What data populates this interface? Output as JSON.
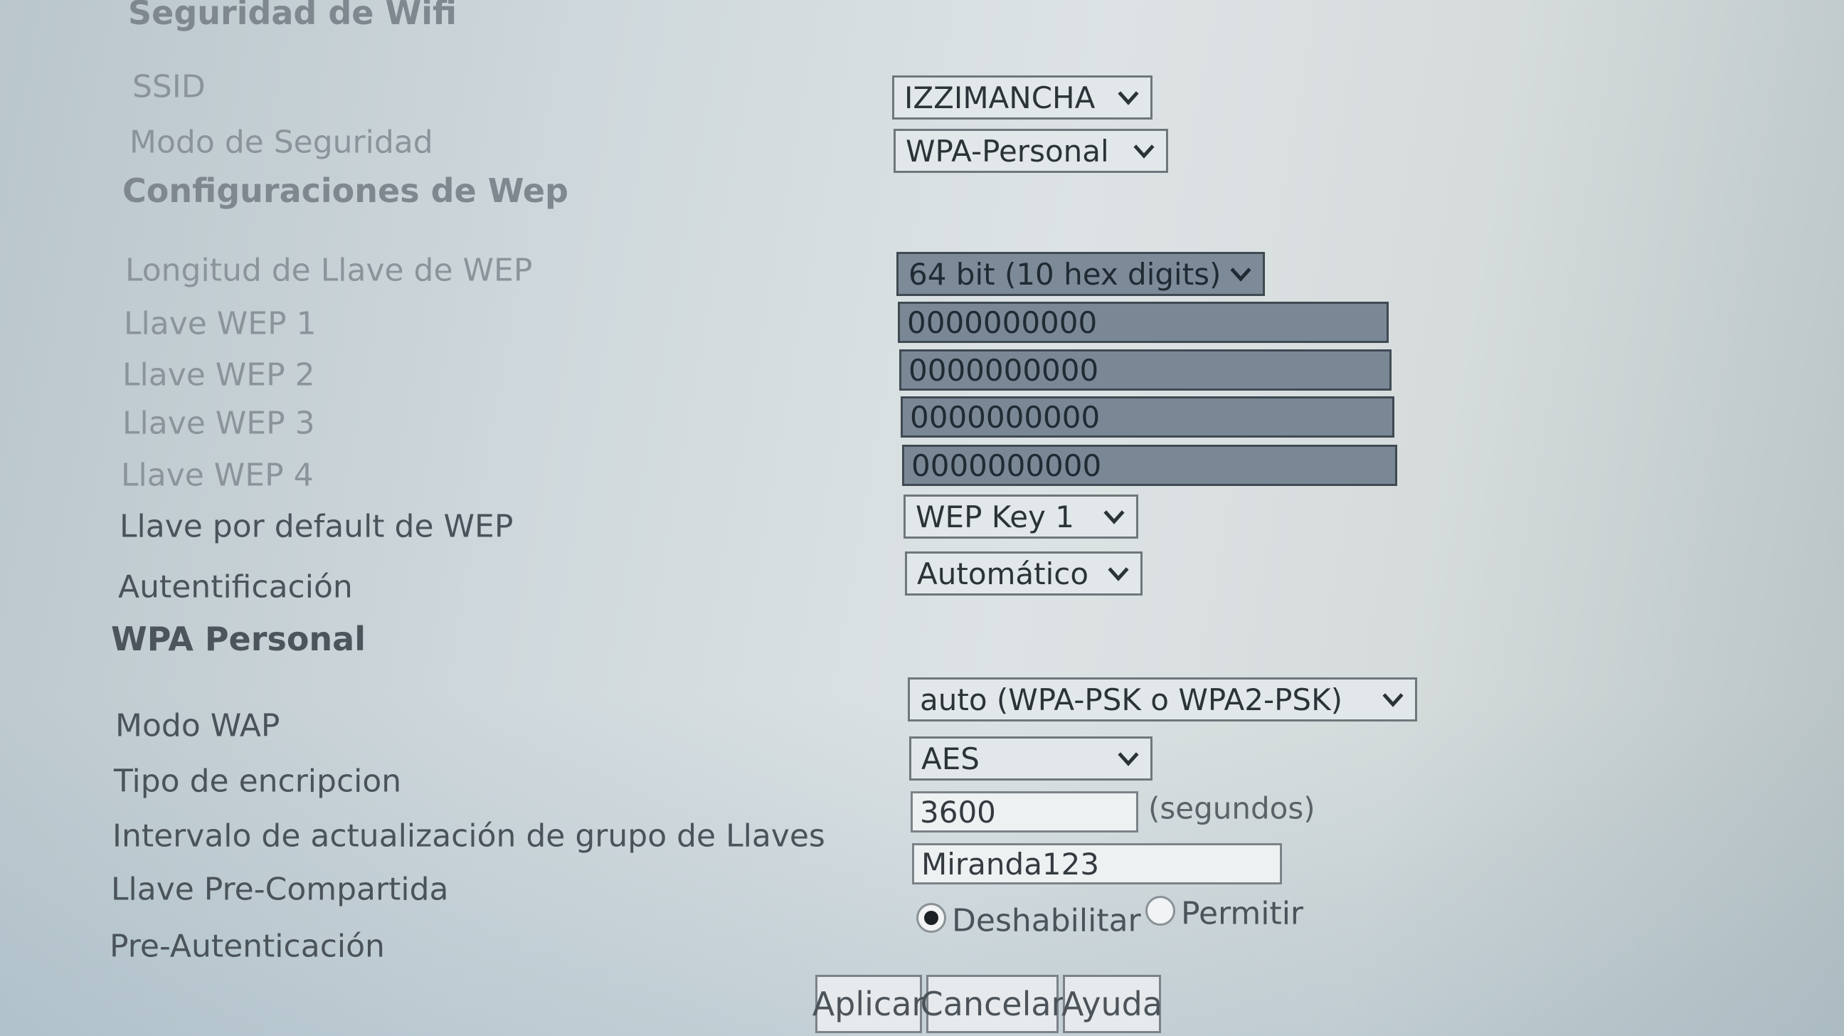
{
  "section_titles": {
    "wifi_security": "Seguridad de Wifi",
    "wep_settings": "Configuraciones de Wep",
    "wpa_personal": "WPA Personal"
  },
  "fields": {
    "ssid": {
      "label": "SSID",
      "value": "IZZIMANCHA"
    },
    "security_mode": {
      "label": "Modo de Seguridad",
      "value": "WPA-Personal"
    },
    "wep_key_length": {
      "label": "Longitud de Llave de WEP",
      "value": "64 bit (10 hex digits)"
    },
    "wep_key_1": {
      "label": "Llave WEP 1",
      "value": "0000000000"
    },
    "wep_key_2": {
      "label": "Llave WEP 2",
      "value": "0000000000"
    },
    "wep_key_3": {
      "label": "Llave WEP 3",
      "value": "0000000000"
    },
    "wep_key_4": {
      "label": "Llave WEP 4",
      "value": "0000000000"
    },
    "wep_default_key": {
      "label": "Llave por default de WEP",
      "value": "WEP Key 1"
    },
    "authentication": {
      "label": "Autentificación",
      "value": "Automático"
    },
    "wpa_mode": {
      "label": "Modo WAP",
      "value": "auto (WPA-PSK o WPA2-PSK)"
    },
    "encryption_type": {
      "label": "Tipo de encripcion",
      "value": "AES"
    },
    "group_key_interval": {
      "label": "Intervalo de actualización de grupo de Llaves",
      "value": "3600",
      "unit": "(segundos)"
    },
    "pre_shared_key": {
      "label": "Llave Pre-Compartida",
      "value": "Miranda123"
    },
    "pre_authentication": {
      "label": "Pre-Autenticación",
      "options": [
        "Deshabilitar",
        "Permitir"
      ],
      "selected": "Deshabilitar"
    }
  },
  "buttons": {
    "apply": "Aplicar",
    "cancel": "Cancelar",
    "help": "Ayuda"
  }
}
